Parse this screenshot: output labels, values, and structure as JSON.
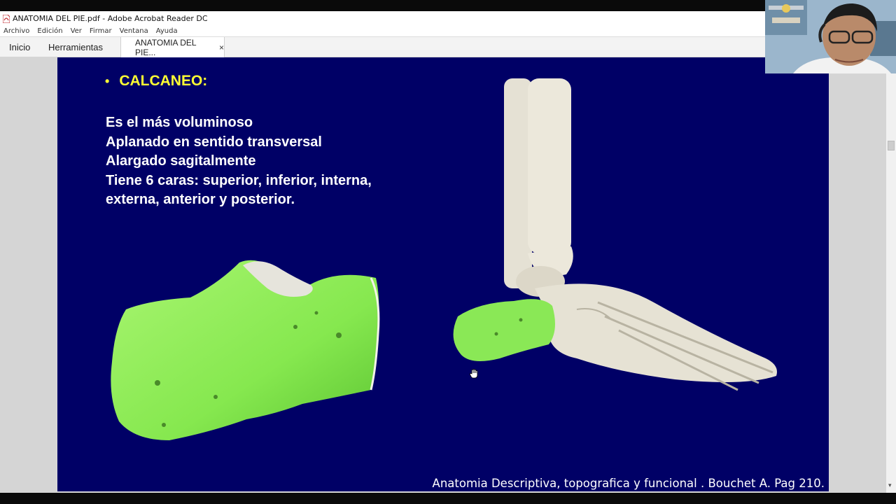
{
  "window": {
    "title": "ANATOMIA DEL PIE.pdf - Adobe Acrobat Reader DC"
  },
  "menu": {
    "items": [
      "Archivo",
      "Edición",
      "Ver",
      "Firmar",
      "Ventana",
      "Ayuda"
    ]
  },
  "tabs": {
    "home": "Inicio",
    "tools": "Herramientas",
    "document": "ANATOMIA DEL PIE...",
    "close": "×"
  },
  "slide": {
    "bullet": "•",
    "heading": "CALCANEO:",
    "lines": [
      "Es el más voluminoso",
      "Aplanado en sentido transversal",
      "Alargado sagitalmente",
      "Tiene 6 caras: superior, inferior, interna,",
      "externa, anterior y posterior."
    ],
    "caption": "Anatomia Descriptiva, topografica y funcional . Bouchet  A. Pag 210.",
    "background_color": "#000066",
    "heading_color": "#ffff33",
    "bone_highlight_color": "#88ee55"
  },
  "icons": {
    "app": "pdf-icon",
    "cursor": "hand-cursor-icon",
    "scroll_down": "chevron-down-icon"
  }
}
